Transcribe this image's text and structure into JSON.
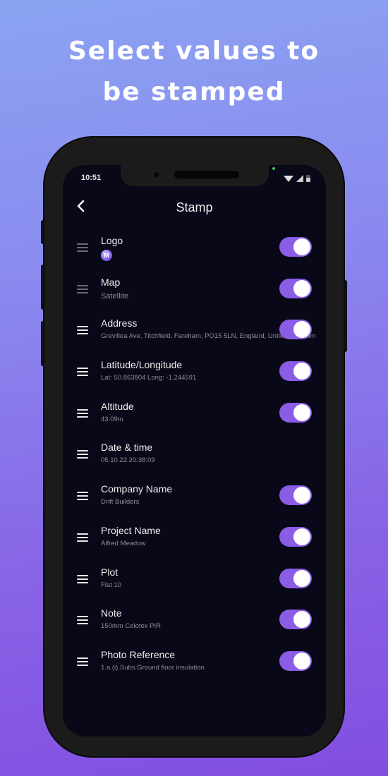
{
  "promo": {
    "headline_line1": "Select values to",
    "headline_line2": "be stamped"
  },
  "status_bar": {
    "time": "10:51",
    "icons": [
      "wifi-icon",
      "signal-icon",
      "battery-icon"
    ]
  },
  "header": {
    "back_icon": "chevron-left-icon",
    "title": "Stamp"
  },
  "colors": {
    "accent": "#8b5ce6",
    "screen_bg": "#080818",
    "bg_top": "#8ba3f1",
    "bg_bottom": "#824ee0"
  },
  "items": [
    {
      "label": "Logo",
      "value": "M",
      "value_type": "logo-icon",
      "enabled": true,
      "drag_dimmed": true
    },
    {
      "label": "Map",
      "value": "Satellite",
      "enabled": true,
      "drag_dimmed": true
    },
    {
      "label": "Address",
      "value": "Grevillea Ave, Titchfield, Fareham, PO15 5LN, England, United Kingdom",
      "enabled": true
    },
    {
      "label": "Latitude/Longitude",
      "value": "Lat: 50.863804 Long: -1.244591",
      "enabled": true
    },
    {
      "label": "Altitude",
      "value": "43.09m",
      "enabled": true
    },
    {
      "label": "Date & time",
      "value": "05.10.22 20:38:09",
      "enabled": false
    },
    {
      "label": "Company Name",
      "value": "Drift Builders",
      "enabled": true
    },
    {
      "label": "Project Name",
      "value": "Alfred Meadow",
      "enabled": true
    },
    {
      "label": "Plot",
      "value": "Flat 10",
      "enabled": true
    },
    {
      "label": "Note",
      "value": " 150mm Celotex PIR",
      "enabled": true
    },
    {
      "label": "Photo Reference",
      "value": "1.a.(i).Subs.Ground floor insulation",
      "enabled": true
    }
  ]
}
